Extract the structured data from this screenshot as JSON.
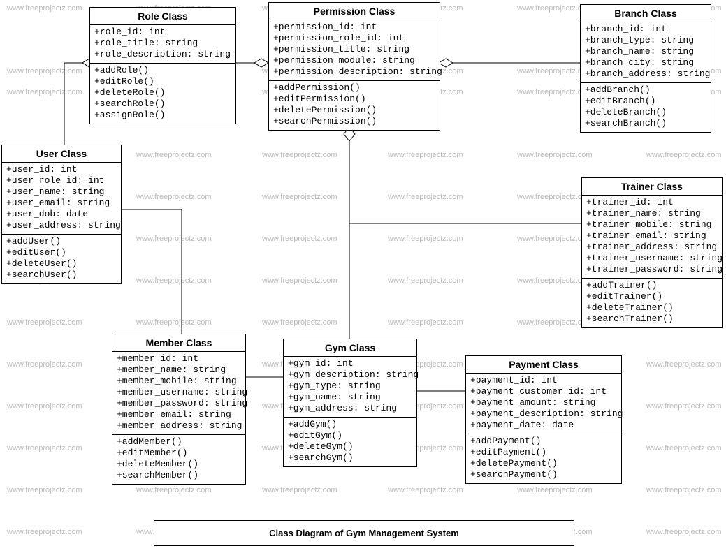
{
  "caption": "Class Diagram of Gym Management System",
  "watermark_text": "www.freeprojectz.com",
  "classes": {
    "role": {
      "title": "Role Class",
      "attrs": [
        "+role_id: int",
        "+role_title: string",
        "+role_description: string"
      ],
      "methods": [
        "+addRole()",
        "+editRole()",
        "+deleteRole()",
        "+searchRole()",
        "+assignRole()"
      ]
    },
    "permission": {
      "title": "Permission Class",
      "attrs": [
        "+permission_id: int",
        "+permission_role_id: int",
        "+permission_title: string",
        "+permission_module: string",
        "+permission_description: string"
      ],
      "methods": [
        "+addPermission()",
        "+editPermission()",
        "+deletePermission()",
        "+searchPermission()"
      ]
    },
    "branch": {
      "title": "Branch Class",
      "attrs": [
        "+branch_id: int",
        "+branch_type: string",
        "+branch_name: string",
        "+branch_city: string",
        "+branch_address: string"
      ],
      "methods": [
        "+addBranch()",
        "+editBranch()",
        "+deleteBranch()",
        "+searchBranch()"
      ]
    },
    "user": {
      "title": "User Class",
      "attrs": [
        "+user_id: int",
        "+user_role_id: int",
        "+user_name: string",
        "+user_email: string",
        "+user_dob: date",
        "+user_address: string"
      ],
      "methods": [
        "+addUser()",
        "+editUser()",
        "+deleteUser()",
        "+searchUser()"
      ]
    },
    "trainer": {
      "title": "Trainer Class",
      "attrs": [
        "+trainer_id: int",
        "+trainer_name: string",
        "+trainer_mobile: string",
        "+trainer_email: string",
        "+trainer_address: string",
        "+trainer_username: string",
        "+trainer_password: string"
      ],
      "methods": [
        "+addTrainer()",
        "+editTrainer()",
        "+deleteTrainer()",
        "+searchTrainer()"
      ]
    },
    "member": {
      "title": "Member Class",
      "attrs": [
        "+member_id: int",
        "+member_name: string",
        "+member_mobile: string",
        "+member_username: string",
        "+member_password: string",
        "+member_email: string",
        "+member_address: string"
      ],
      "methods": [
        "+addMember()",
        "+editMember()",
        "+deleteMember()",
        "+searchMember()"
      ]
    },
    "gym": {
      "title": "Gym Class",
      "attrs": [
        "+gym_id: int",
        "+gym_description: string",
        "+gym_type: string",
        "+gym_name: string",
        "+gym_address: string"
      ],
      "methods": [
        "+addGym()",
        "+editGym()",
        "+deleteGym()",
        "+searchGym()"
      ]
    },
    "payment": {
      "title": "Payment Class",
      "attrs": [
        "+payment_id: int",
        "+payment_customer_id: int",
        "+payment_amount: string",
        "+payment_description: string",
        "+payment_date: date"
      ],
      "methods": [
        "+addPayment()",
        "+editPayment()",
        "+deletePayment()",
        "+searchPayment()"
      ]
    }
  }
}
